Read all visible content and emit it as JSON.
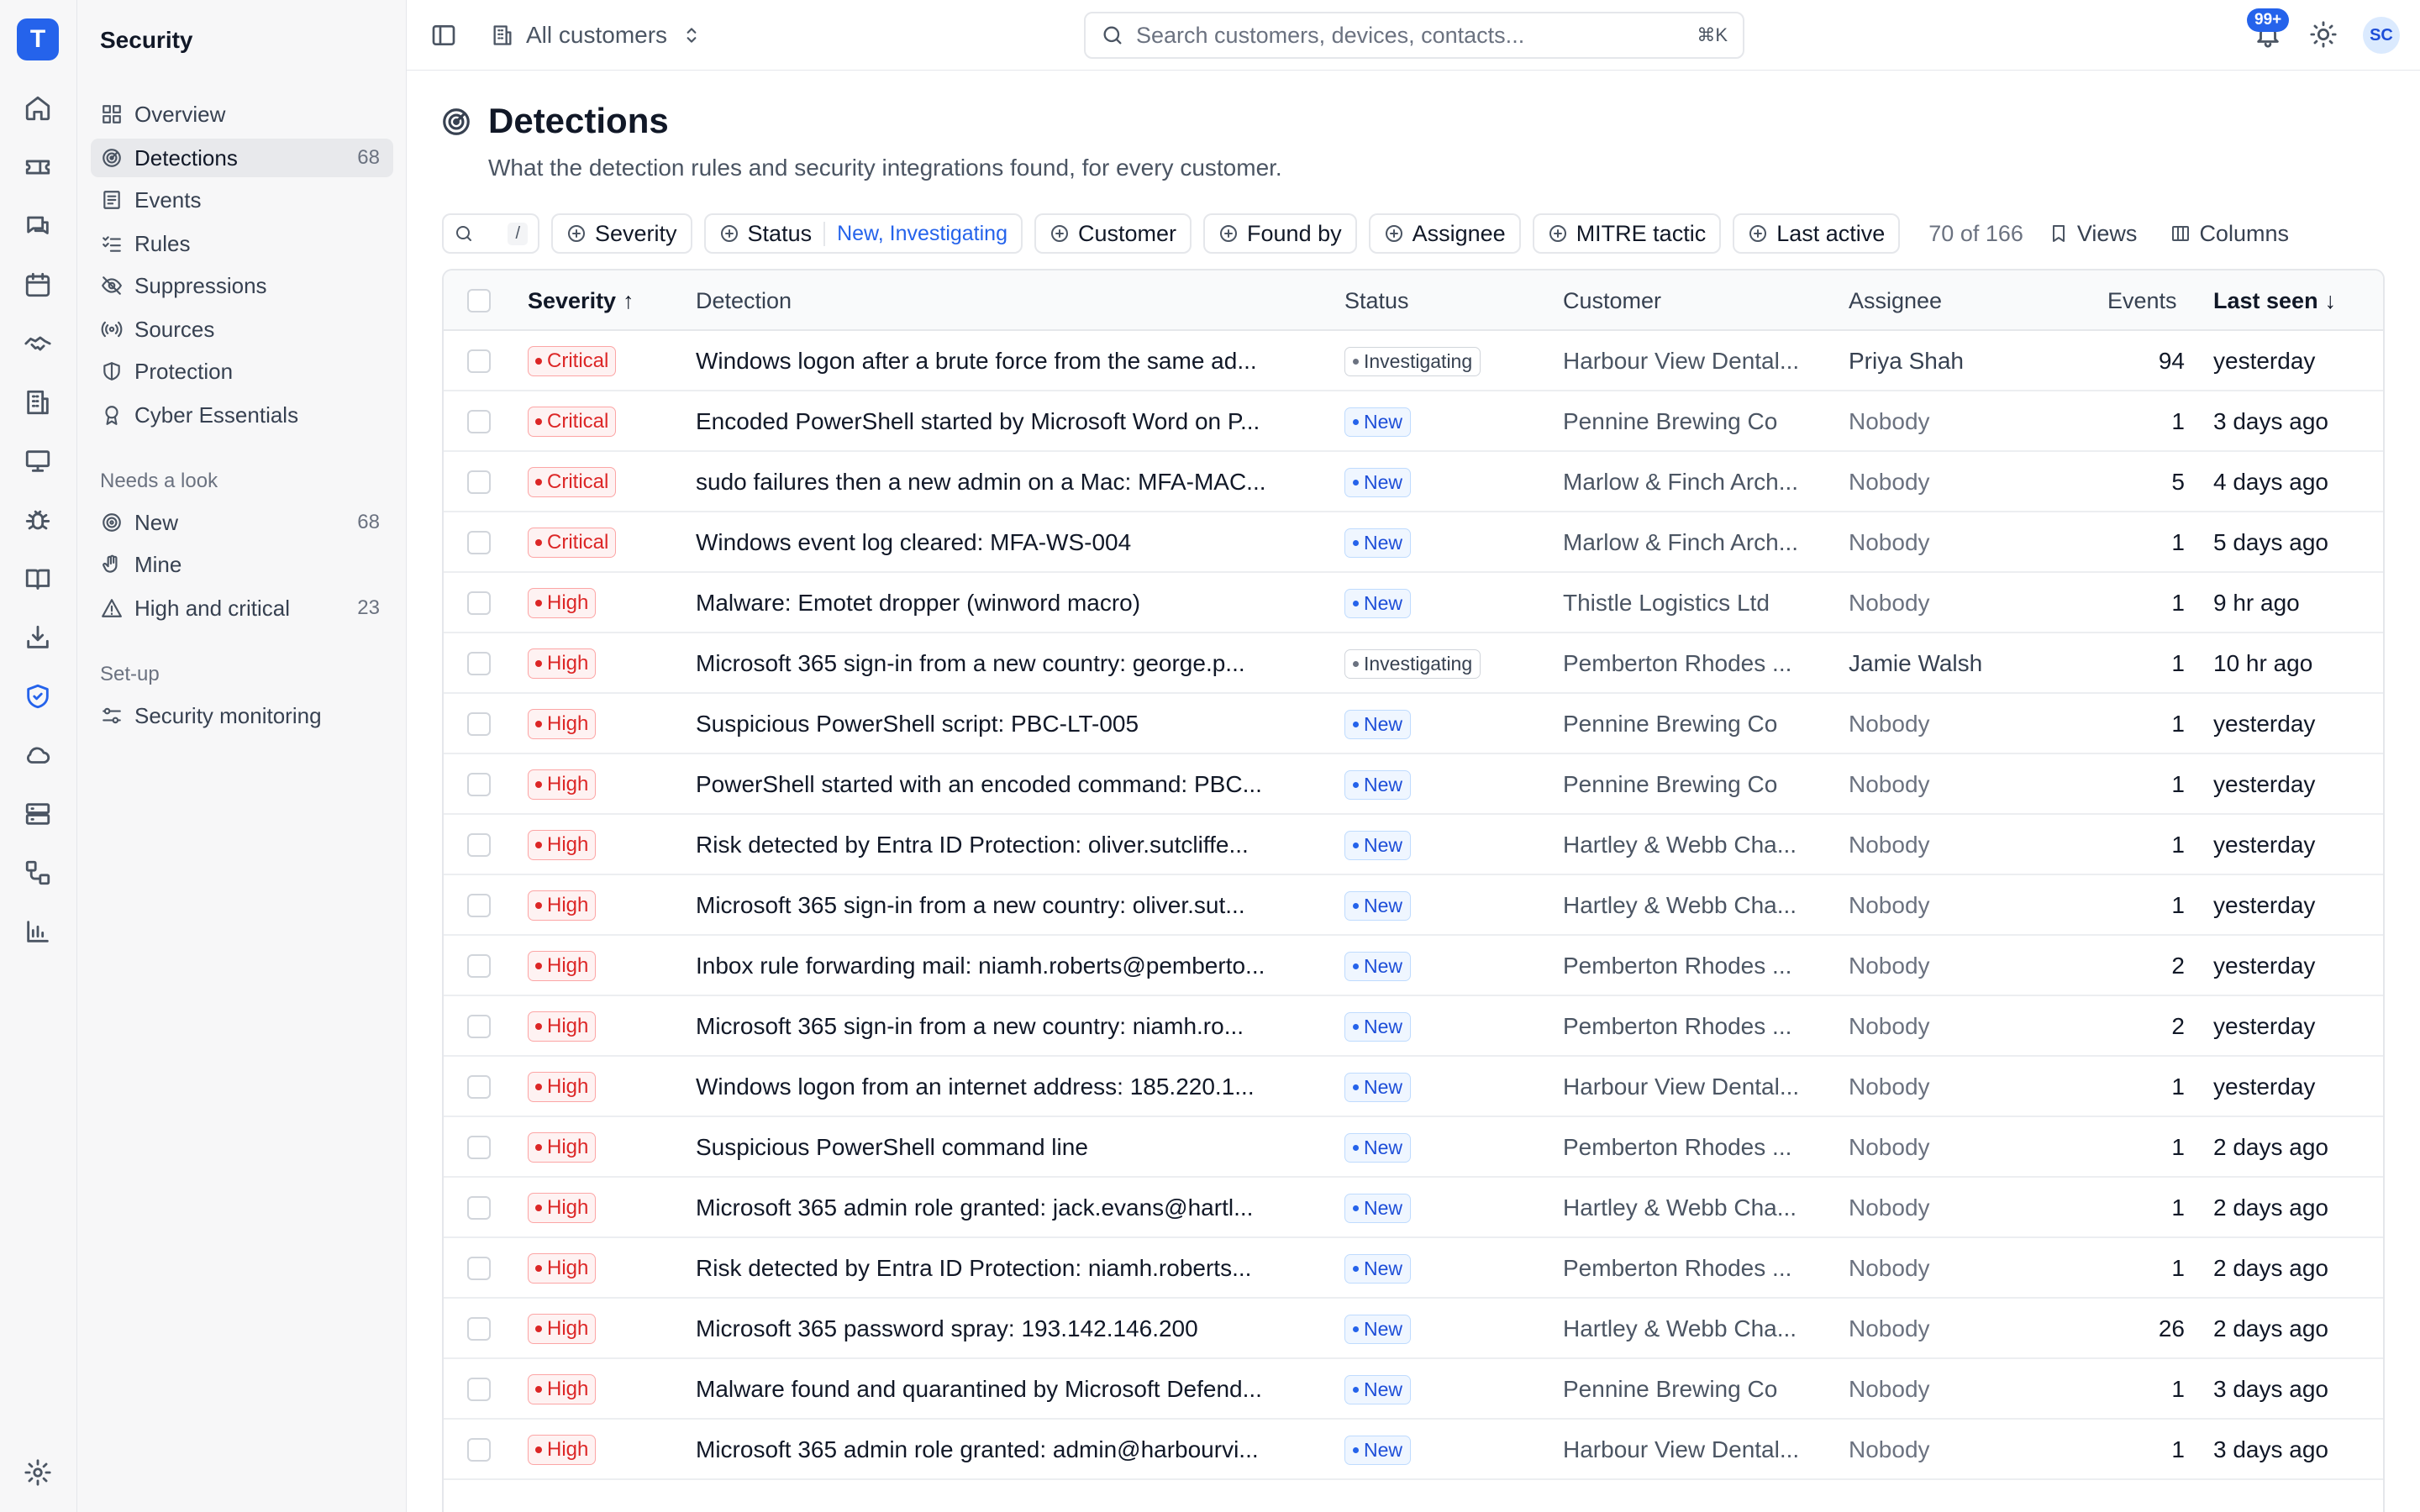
{
  "app": {
    "logo_letter": "T"
  },
  "rail_icons": [
    "home-icon",
    "ticket-icon",
    "chat-icon",
    "calendar-icon",
    "handshake-icon",
    "building-icon",
    "monitor-icon",
    "bug-icon",
    "book-icon",
    "download-icon",
    "shield-icon",
    "cloud-icon",
    "server-icon",
    "workflow-icon",
    "chart-icon",
    "settings-icon"
  ],
  "sidebar": {
    "title": "Security",
    "items": [
      {
        "label": "Overview",
        "icon": "grid-icon",
        "count": ""
      },
      {
        "label": "Detections",
        "icon": "radar-icon",
        "count": "68",
        "active": true
      },
      {
        "label": "Events",
        "icon": "list-icon",
        "count": ""
      },
      {
        "label": "Rules",
        "icon": "checklist-icon",
        "count": ""
      },
      {
        "label": "Suppressions",
        "icon": "eye-off-icon",
        "count": ""
      },
      {
        "label": "Sources",
        "icon": "broadcast-icon",
        "count": ""
      },
      {
        "label": "Protection",
        "icon": "shield-half-icon",
        "count": ""
      },
      {
        "label": "Cyber Essentials",
        "icon": "badge-icon",
        "count": ""
      }
    ],
    "sections": [
      {
        "title": "Needs a look",
        "items": [
          {
            "label": "New",
            "icon": "target-icon",
            "count": "68"
          },
          {
            "label": "Mine",
            "icon": "hand-icon",
            "count": ""
          },
          {
            "label": "High and critical",
            "icon": "alert-triangle-icon",
            "count": "23"
          }
        ]
      },
      {
        "title": "Set-up",
        "items": [
          {
            "label": "Security monitoring",
            "icon": "sliders-icon",
            "count": ""
          }
        ]
      }
    ]
  },
  "topbar": {
    "customer_label": "All customers",
    "search_placeholder": "Search customers, devices, contacts...",
    "search_shortcut": "⌘K",
    "notification_badge": "99+",
    "avatar_initials": "SC"
  },
  "page": {
    "title": "Detections",
    "subtitle": "What the detection rules and security integrations found, for every customer."
  },
  "filters": {
    "search_shortcut": "/",
    "chips": [
      {
        "label": "Severity",
        "value": ""
      },
      {
        "label": "Status",
        "value": "New, Investigating"
      },
      {
        "label": "Customer",
        "value": ""
      },
      {
        "label": "Found by",
        "value": ""
      },
      {
        "label": "Assignee",
        "value": ""
      },
      {
        "label": "MITRE tactic",
        "value": ""
      },
      {
        "label": "Last active",
        "value": ""
      }
    ],
    "count": "70 of 166",
    "views_label": "Views",
    "columns_label": "Columns"
  },
  "table": {
    "headers": {
      "severity": "Severity",
      "detection": "Detection",
      "status": "Status",
      "customer": "Customer",
      "assignee": "Assignee",
      "events": "Events",
      "last_seen": "Last seen"
    },
    "sort_icons": {
      "severity": "↑",
      "last_seen": "↓"
    },
    "rows": [
      {
        "severity": "Critical",
        "detection": "Windows logon after a brute force from the same ad...",
        "status": "Investigating",
        "customer": "Harbour View Dental...",
        "assignee": "Priya Shah",
        "events": "94",
        "last_seen": "yesterday"
      },
      {
        "severity": "Critical",
        "detection": "Encoded PowerShell started by Microsoft Word on P...",
        "status": "New",
        "customer": "Pennine Brewing Co",
        "assignee": "Nobody",
        "events": "1",
        "last_seen": "3 days ago"
      },
      {
        "severity": "Critical",
        "detection": "sudo failures then a new admin on a Mac: MFA-MAC...",
        "status": "New",
        "customer": "Marlow & Finch Arch...",
        "assignee": "Nobody",
        "events": "5",
        "last_seen": "4 days ago"
      },
      {
        "severity": "Critical",
        "detection": "Windows event log cleared: MFA-WS-004",
        "status": "New",
        "customer": "Marlow & Finch Arch...",
        "assignee": "Nobody",
        "events": "1",
        "last_seen": "5 days ago"
      },
      {
        "severity": "High",
        "detection": "Malware: Emotet dropper (winword macro)",
        "status": "New",
        "customer": "Thistle Logistics Ltd",
        "assignee": "Nobody",
        "events": "1",
        "last_seen": "9 hr ago"
      },
      {
        "severity": "High",
        "detection": "Microsoft 365 sign-in from a new country: george.p...",
        "status": "Investigating",
        "customer": "Pemberton Rhodes ...",
        "assignee": "Jamie Walsh",
        "events": "1",
        "last_seen": "10 hr ago"
      },
      {
        "severity": "High",
        "detection": "Suspicious PowerShell script: PBC-LT-005",
        "status": "New",
        "customer": "Pennine Brewing Co",
        "assignee": "Nobody",
        "events": "1",
        "last_seen": "yesterday"
      },
      {
        "severity": "High",
        "detection": "PowerShell started with an encoded command: PBC...",
        "status": "New",
        "customer": "Pennine Brewing Co",
        "assignee": "Nobody",
        "events": "1",
        "last_seen": "yesterday"
      },
      {
        "severity": "High",
        "detection": "Risk detected by Entra ID Protection: oliver.sutcliffe...",
        "status": "New",
        "customer": "Hartley & Webb Cha...",
        "assignee": "Nobody",
        "events": "1",
        "last_seen": "yesterday"
      },
      {
        "severity": "High",
        "detection": "Microsoft 365 sign-in from a new country: oliver.sut...",
        "status": "New",
        "customer": "Hartley & Webb Cha...",
        "assignee": "Nobody",
        "events": "1",
        "last_seen": "yesterday"
      },
      {
        "severity": "High",
        "detection": "Inbox rule forwarding mail: niamh.roberts@pemberto...",
        "status": "New",
        "customer": "Pemberton Rhodes ...",
        "assignee": "Nobody",
        "events": "2",
        "last_seen": "yesterday"
      },
      {
        "severity": "High",
        "detection": "Microsoft 365 sign-in from a new country: niamh.ro...",
        "status": "New",
        "customer": "Pemberton Rhodes ...",
        "assignee": "Nobody",
        "events": "2",
        "last_seen": "yesterday"
      },
      {
        "severity": "High",
        "detection": "Windows logon from an internet address: 185.220.1...",
        "status": "New",
        "customer": "Harbour View Dental...",
        "assignee": "Nobody",
        "events": "1",
        "last_seen": "yesterday"
      },
      {
        "severity": "High",
        "detection": "Suspicious PowerShell command line",
        "status": "New",
        "customer": "Pemberton Rhodes ...",
        "assignee": "Nobody",
        "events": "1",
        "last_seen": "2 days ago"
      },
      {
        "severity": "High",
        "detection": "Microsoft 365 admin role granted: jack.evans@hartl...",
        "status": "New",
        "customer": "Hartley & Webb Cha...",
        "assignee": "Nobody",
        "events": "1",
        "last_seen": "2 days ago"
      },
      {
        "severity": "High",
        "detection": "Risk detected by Entra ID Protection: niamh.roberts...",
        "status": "New",
        "customer": "Pemberton Rhodes ...",
        "assignee": "Nobody",
        "events": "1",
        "last_seen": "2 days ago"
      },
      {
        "severity": "High",
        "detection": "Microsoft 365 password spray: 193.142.146.200",
        "status": "New",
        "customer": "Hartley & Webb Cha...",
        "assignee": "Nobody",
        "events": "26",
        "last_seen": "2 days ago"
      },
      {
        "severity": "High",
        "detection": "Malware found and quarantined by Microsoft Defend...",
        "status": "New",
        "customer": "Pennine Brewing Co",
        "assignee": "Nobody",
        "events": "1",
        "last_seen": "3 days ago"
      },
      {
        "severity": "High",
        "detection": "Microsoft 365 admin role granted: admin@harbourvi...",
        "status": "New",
        "customer": "Harbour View Dental...",
        "assignee": "Nobody",
        "events": "1",
        "last_seen": "3 days ago"
      }
    ]
  }
}
